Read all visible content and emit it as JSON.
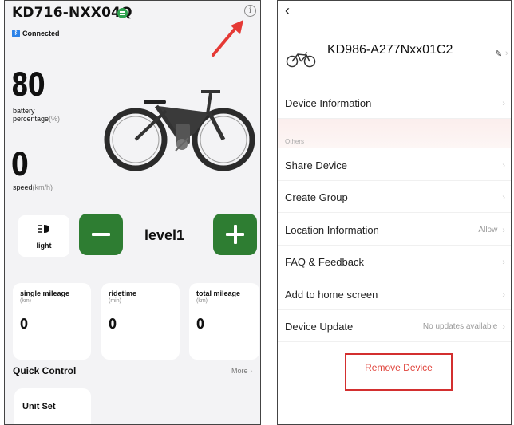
{
  "left_screen": {
    "device_title": "KD716-NXX04Q",
    "connection_status": "Connected",
    "battery": {
      "value": "80",
      "label": "battery",
      "label2": "percentage",
      "unit": "(%)"
    },
    "speed": {
      "value": "0",
      "label": "speed",
      "unit": "(km/h)"
    },
    "light": {
      "label": "light"
    },
    "assist": {
      "level_label": "level1",
      "minus_icon": "minus-icon",
      "plus_icon": "plus-icon"
    },
    "stats": [
      {
        "title": "single mileage",
        "unit": "(km)",
        "value": "0"
      },
      {
        "title": "ridetime",
        "unit": "(min)",
        "value": "0"
      },
      {
        "title": "total mileage",
        "unit": "(km)",
        "value": "0"
      }
    ],
    "quick_control": {
      "title": "Quick Control",
      "more_label": "More"
    },
    "cards": [
      {
        "label": "Unit Set"
      }
    ],
    "colors": {
      "accent_green": "#2e7d32",
      "annotation_red": "#e53935",
      "connected_blue": "#2c82e8"
    }
  },
  "right_screen": {
    "back_icon": "back-chevron-icon",
    "device_name": "KD986-A277Nxx01C2",
    "rows_top": [
      {
        "label": "Device Information"
      }
    ],
    "section_label": "Others",
    "rows": [
      {
        "label": "Share Device",
        "value": ""
      },
      {
        "label": "Create Group",
        "value": ""
      },
      {
        "label": "Location Information",
        "value": "Allow"
      },
      {
        "label": "FAQ & Feedback",
        "value": ""
      },
      {
        "label": "Add to home screen",
        "value": ""
      },
      {
        "label": "Device Update",
        "value": "No updates available"
      }
    ],
    "remove_button": "Remove Device",
    "colors": {
      "remove_red": "#e0443c",
      "highlight_box": "#d32f2f"
    }
  }
}
